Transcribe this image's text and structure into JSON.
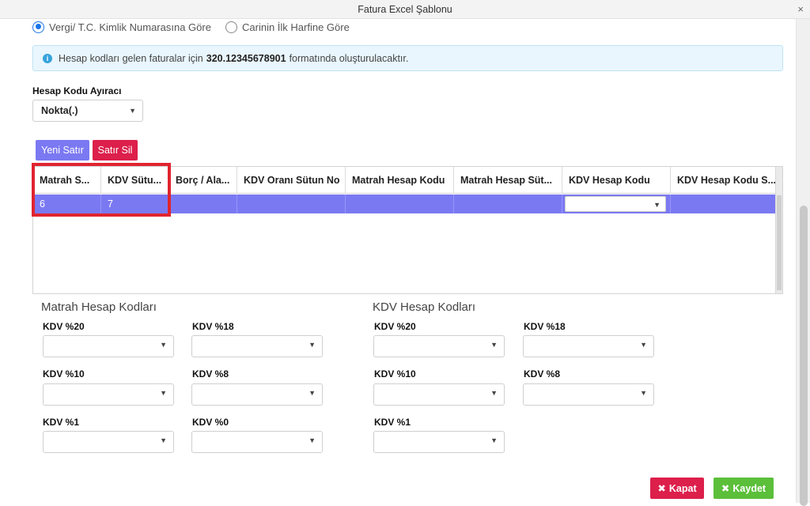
{
  "window": {
    "title": "Fatura Excel Şablonu",
    "close_glyph": "×"
  },
  "radios": [
    {
      "label": "Vergi/ T.C. Kimlik Numarasına Göre",
      "checked": true
    },
    {
      "label": "Carinin İlk Harfine Göre",
      "checked": false
    }
  ],
  "info": {
    "icon": "info-icon",
    "text_before": "Hesap kodları gelen faturalar için",
    "code": "320.12345678901",
    "text_after": "formatında oluşturulacaktır."
  },
  "separator": {
    "label": "Hesap Kodu Ayıracı",
    "value": "Nokta(.)"
  },
  "toolbar": {
    "add_label": "Yeni Satır",
    "delete_label": "Satır Sil"
  },
  "grid": {
    "headers": [
      "Matrah S...",
      "KDV Sütu...",
      "Borç / Ala...",
      "KDV Oranı Sütun No",
      "Matrah Hesap Kodu",
      "Matrah Hesap Süt...",
      "KDV Hesap Kodu",
      "KDV Hesap Kodu S..."
    ],
    "row": [
      "6",
      "7",
      "",
      "",
      "",
      "",
      "",
      ""
    ]
  },
  "matrah": {
    "title": "Matrah Hesap Kodları",
    "fields": [
      "KDV %20",
      "KDV %18",
      "KDV %10",
      "KDV %8",
      "KDV %1",
      "KDV %0"
    ]
  },
  "kdv": {
    "title": "KDV Hesap Kodları",
    "fields": [
      "KDV %20",
      "KDV %18",
      "KDV %10",
      "KDV %8",
      "KDV %1"
    ]
  },
  "footer": {
    "close_label": "Kapat",
    "save_label": "Kaydet"
  },
  "colors": {
    "accent": "#7b79f2",
    "danger": "#dc1f4b",
    "success": "#5bbf3a",
    "info_bg": "#e9f6fd",
    "highlight": "#e0242f"
  }
}
